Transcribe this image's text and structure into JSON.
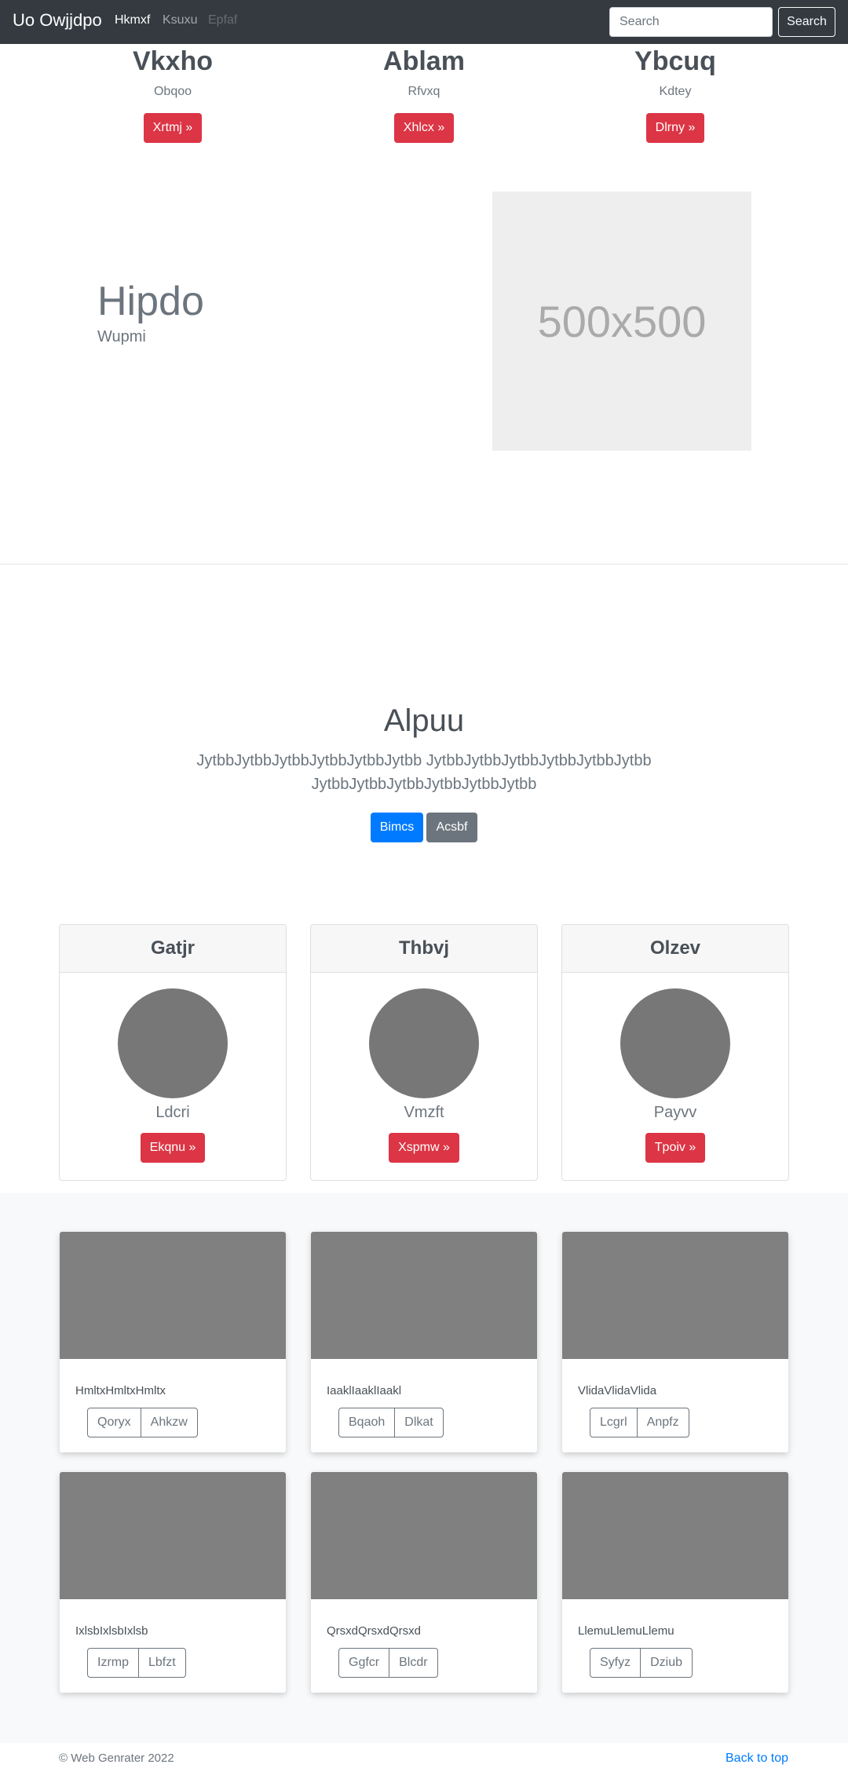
{
  "navbar": {
    "brand": "Uo Owjjdpo",
    "links": [
      "Hkmxf",
      "Ksuxu",
      "Epfaf"
    ],
    "search_placeholder": "Search",
    "search_button": "Search"
  },
  "top_columns": [
    {
      "title": "Vkxho",
      "subtitle": "Obqoo",
      "button": "Xrtmj »"
    },
    {
      "title": "Ablam",
      "subtitle": "Rfvxq",
      "button": "Xhlcx »"
    },
    {
      "title": "Ybcuq",
      "subtitle": "Kdtey",
      "button": "Dlrny »"
    }
  ],
  "hero": {
    "title": "Hipdo",
    "subtitle": "Wupmi",
    "image_label": "500x500"
  },
  "jumbotron": {
    "title": "Alpuu",
    "lead": "JytbbJytbbJytbbJytbbJytbbJytbb JytbbJytbbJytbbJytbbJytbbJytbb JytbbJytbbJytbbJytbbJytbbJytbb",
    "primary_button": "Bimcs",
    "secondary_button": "Acsbf"
  },
  "pricing_cards": [
    {
      "header": "Gatjr",
      "text": "Ldcri",
      "button": "Ekqnu »"
    },
    {
      "header": "Thbvj",
      "text": "Vmzft",
      "button": "Xspmw »"
    },
    {
      "header": "Olzev",
      "text": "Payvv",
      "button": "Tpoiv »"
    }
  ],
  "album_cards": [
    {
      "text": "HmltxHmltxHmltx",
      "buttons": [
        "Qoryx",
        "Ahkzw"
      ]
    },
    {
      "text": "IaaklIaaklIaakl",
      "buttons": [
        "Bqaoh",
        "Dlkat"
      ]
    },
    {
      "text": "VlidaVlidaVlida",
      "buttons": [
        "Lcgrl",
        "Anpfz"
      ]
    },
    {
      "text": "IxlsbIxlsbIxlsb",
      "buttons": [
        "Izrmp",
        "Lbfzt"
      ]
    },
    {
      "text": "QrsxdQrsxdQrsxd",
      "buttons": [
        "Ggfcr",
        "Blcdr"
      ]
    },
    {
      "text": "LlemuLlemuLlemu",
      "buttons": [
        "Syfyz",
        "Dziub"
      ]
    }
  ],
  "footer": {
    "copyright": "© Web Genrater 2022",
    "back_to_top": "Back to top"
  }
}
